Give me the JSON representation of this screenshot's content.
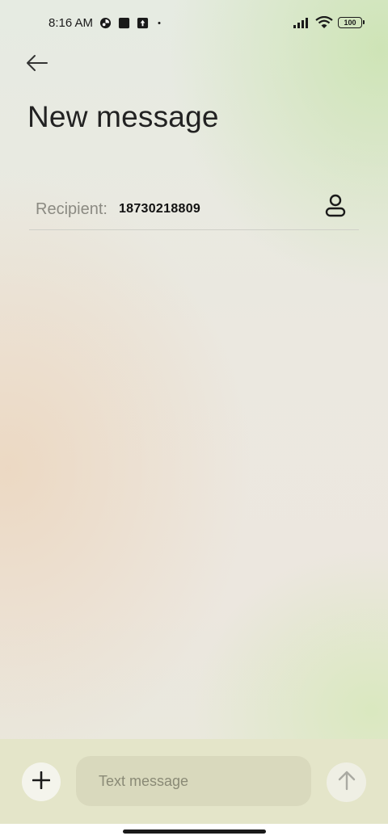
{
  "status_bar": {
    "time": "8:16 AM",
    "icons": [
      "notification-app-icon",
      "square-app-icon",
      "upload-icon",
      "dot-icon"
    ],
    "signal": "signal-icon",
    "wifi": "wifi-icon",
    "battery": "100"
  },
  "header": {
    "back_icon": "arrow-left-icon",
    "title": "New message"
  },
  "recipient": {
    "label": "Recipient:",
    "value": "18730218809",
    "contact_icon": "person-icon"
  },
  "composer": {
    "add_icon": "plus-icon",
    "placeholder": "Text message",
    "send_icon": "arrow-up-icon"
  },
  "colors": {
    "bottom_bar": "#e4e5c9",
    "input_bg": "#d9d9bd",
    "title_text": "#222222"
  }
}
